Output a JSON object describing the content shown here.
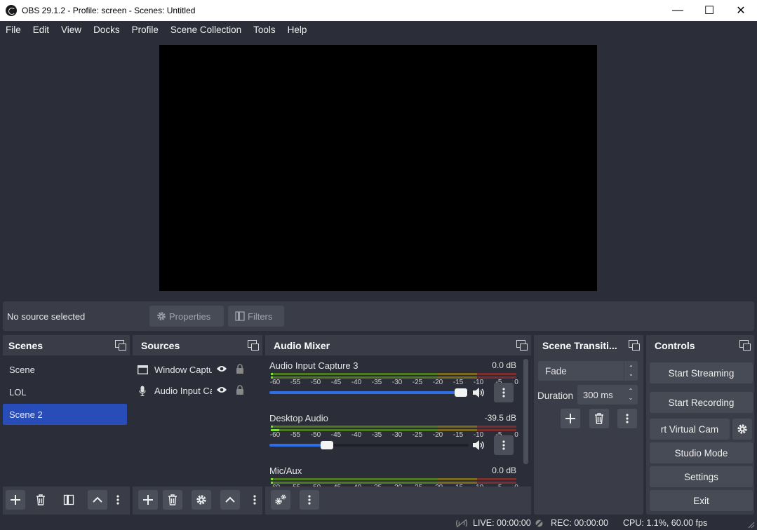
{
  "window": {
    "title": "OBS 29.1.2 - Profile: screen - Scenes: Untitled",
    "minimize": "—",
    "maximize": "☐",
    "close": "✕"
  },
  "menu": [
    "File",
    "Edit",
    "View",
    "Docks",
    "Profile",
    "Scene Collection",
    "Tools",
    "Help"
  ],
  "context": {
    "no_source": "No source selected",
    "properties": "Properties",
    "filters": "Filters"
  },
  "scenes": {
    "title": "Scenes",
    "items": [
      "Scene",
      "LOL",
      "Scene 2"
    ],
    "selected": "Scene 2"
  },
  "sources": {
    "title": "Sources",
    "items": [
      {
        "name": "Window Capture",
        "icon": "window-icon"
      },
      {
        "name": "Audio Input Capture",
        "icon": "microphone-icon"
      }
    ]
  },
  "mixer": {
    "title": "Audio Mixer",
    "ticks": [
      "-60",
      "-55",
      "-50",
      "-45",
      "-40",
      "-35",
      "-30",
      "-25",
      "-20",
      "-15",
      "-10",
      "-5",
      "0"
    ],
    "channels": [
      {
        "name": "Audio Input Capture 3",
        "db": "0.0 dB",
        "fader_level": 0.96
      },
      {
        "name": "Desktop Audio",
        "db": "-39.5 dB",
        "fader_level": 0.29
      },
      {
        "name": "Mic/Aux",
        "db": "0.0 dB"
      }
    ]
  },
  "transitions": {
    "title": "Scene Transiti...",
    "selected": "Fade",
    "duration_label": "Duration",
    "duration_value": "300 ms"
  },
  "controls": {
    "title": "Controls",
    "start_streaming": "Start Streaming",
    "start_recording": "Start Recording",
    "virtual_cam": "rt Virtual Cam",
    "studio_mode": "Studio Mode",
    "settings": "Settings",
    "exit": "Exit"
  },
  "status": {
    "live": "LIVE: 00:00:00",
    "rec": "REC: 00:00:00",
    "cpu": "CPU: 1.1%, 60.00 fps"
  },
  "colors": {
    "accent": "#284cb8",
    "panel": "#3a3d47",
    "background": "#2b2e38",
    "fader": "#2e6ee6"
  }
}
